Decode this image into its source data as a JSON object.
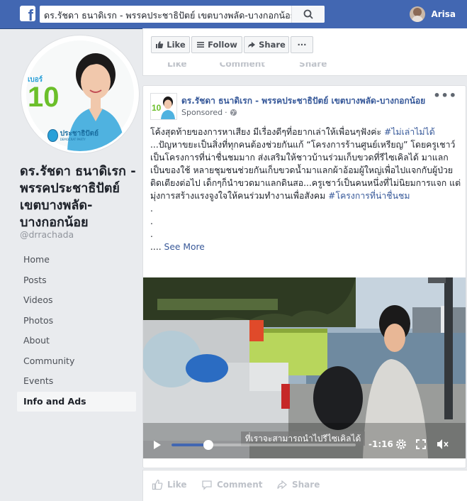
{
  "topbar": {
    "logo": "f",
    "search_value": "ดร.รัชดา ธนาดิเรก - พรรคประชาธิปัตย์ เขตบางพลัด-บางกอกน้อย",
    "user_name": "Arisa"
  },
  "profile": {
    "badge_label": "เบอร์",
    "badge_number": "10",
    "party_logo_text": "ประชาธิปัตย์",
    "party_logo_sub": "DEMOCRAT PARTY"
  },
  "page": {
    "name_line1": "ดร.รัชดา ธนาดิเรก -",
    "name_line2": "พรรคประชาธิปัตย์",
    "name_line3": "เขตบางพลัด-",
    "name_line4": "บางกอกน้อย",
    "handle": "@drrachada"
  },
  "nav": [
    {
      "label": "Home"
    },
    {
      "label": "Posts"
    },
    {
      "label": "Videos"
    },
    {
      "label": "Photos"
    },
    {
      "label": "About"
    },
    {
      "label": "Community"
    },
    {
      "label": "Events"
    },
    {
      "label": "Info and Ads"
    }
  ],
  "actions": {
    "like": "Like",
    "follow": "Follow",
    "share": "Share",
    "more": "···"
  },
  "ghost": {
    "like": "Like",
    "comment": "Comment",
    "share": "Share"
  },
  "post": {
    "author": "ดร.รัชดา ธนาดิเรก - พรรคประชาธิปัตย์ เขตบางพลัด-บางกอกน้อย",
    "sponsored": "Sponsored",
    "more": "•••",
    "line1": "โค้งสุดท้ายของการหาเสียง มีเรื่องดีๆที่อยากเล่าให้เพื่อนๆฟังค่ะ ",
    "tag1": "#ไม่เล่าไม่ได้",
    "line2": "...ปัญหาขยะเป็นสิ่งที่ทุกคนต้องช่วยกันแก้ “โครงการร้านศูนย์เหรียญ” โดยครูเชาว์ เป็นโครงการที่น่าชื่นชมมาก ส่งเสริมให้ชาวบ้านร่วมเก็บขวดที่รีไซเคิลได้ มาแลกเป็นของใช้ หลายชุมชนช่วยกันเก็บขวดน้ำมาแลกผ้าอ้อมผู้ใหญ่เพื่อไปแจกกับผู้ป่วยติดเตียงต่อไป เด็กๆก็นำขวดมาแลกดินสอ...ครูเชาว์เป็นคนหนึ่งที่ไม่นิยมการแจก แต่มุ่งการสร้างแรงจูงใจให้คนร่วมทำงานเพื่อสังคม ",
    "tag2": "#โครงการที่น่าชื่นชม",
    "dot": ".",
    "see_more_prefix": ".... ",
    "see_more": "See More"
  },
  "video": {
    "subtitle": "ที่เราจะสามารถนำไปรีไซเคิลได้",
    "time": "-1:16",
    "progress": 0.2
  },
  "footer": {
    "like": "Like",
    "comment": "Comment",
    "share": "Share"
  }
}
